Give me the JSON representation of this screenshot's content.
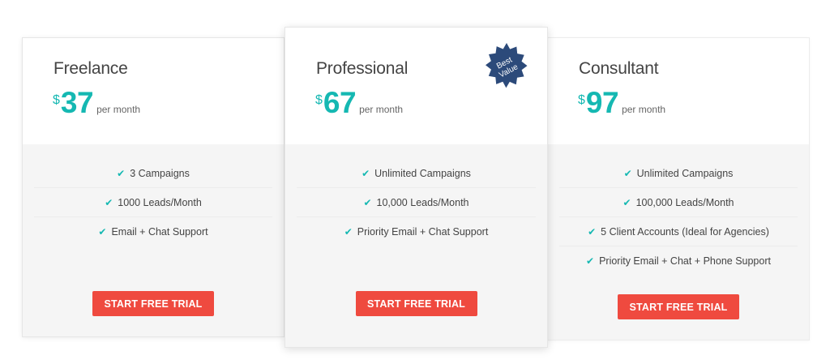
{
  "colors": {
    "accent": "#15b8b2",
    "cta": "#ef4a3f",
    "badge": "#2c4a7a",
    "card_body": "#f5f5f5"
  },
  "plans": [
    {
      "name": "Freelance",
      "currency": "$",
      "price": "37",
      "period": "per month",
      "features": [
        "3 Campaigns",
        "1000 Leads/Month",
        "Email + Chat Support"
      ],
      "cta": "START FREE TRIAL"
    },
    {
      "name": "Professional",
      "currency": "$",
      "price": "67",
      "period": "per month",
      "badge_line1": "Best",
      "badge_line2": "Value",
      "features": [
        "Unlimited Campaigns",
        "10,000 Leads/Month",
        "Priority Email + Chat Support"
      ],
      "cta": "START FREE TRIAL"
    },
    {
      "name": "Consultant",
      "currency": "$",
      "price": "97",
      "period": "per month",
      "features": [
        "Unlimited Campaigns",
        "100,000 Leads/Month",
        "5 Client Accounts (Ideal for Agencies)",
        "Priority Email + Chat + Phone Support"
      ],
      "cta": "START FREE TRIAL"
    }
  ],
  "icons": {
    "feature_check": "check-icon",
    "badge_shape": "starburst-badge-icon"
  }
}
